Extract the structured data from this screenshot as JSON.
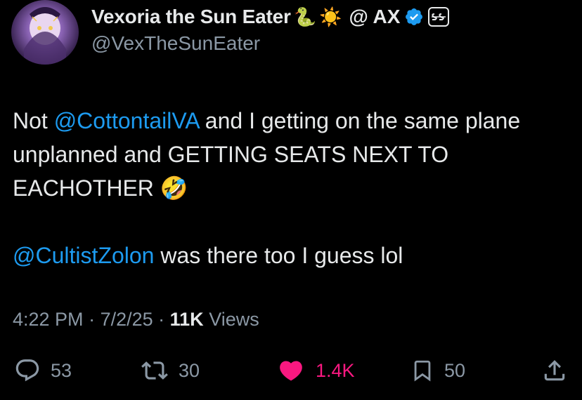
{
  "tweet": {
    "author": {
      "display_name": "Vexoria the Sun Eater",
      "emojis": [
        "🐍",
        "☀️"
      ],
      "affiliation": "@ AX",
      "handle": "@VexTheSunEater",
      "verified": true
    },
    "body": {
      "p1_prefix": "Not ",
      "p1_mention": "@CottontailVA",
      "p1_suffix": " and I getting on the same plane unplanned and GETTING SEATS NEXT TO EACHOTHER ",
      "p1_emoji": "🤣",
      "p2_mention": "@CultistZolon",
      "p2_suffix": " was there too I guess lol"
    },
    "meta": {
      "time": "4:22 PM",
      "sep1": " · ",
      "date": "7/2/25",
      "sep2": " · ",
      "views_count": "11K",
      "views_label": " Views"
    },
    "actions": {
      "replies": "53",
      "reposts": "30",
      "likes": "1.4K",
      "bookmarks": "50"
    }
  },
  "colors": {
    "background": "#000000",
    "text": "#e7e9ea",
    "secondary": "#8b98a5",
    "link": "#1d9bf0",
    "like": "#f91880",
    "verified": "#1d9bf0"
  },
  "icons": [
    "reply-icon",
    "repost-icon",
    "heart-icon",
    "bookmark-icon",
    "share-icon",
    "verified-badge-icon",
    "affiliation-badge-icon"
  ]
}
